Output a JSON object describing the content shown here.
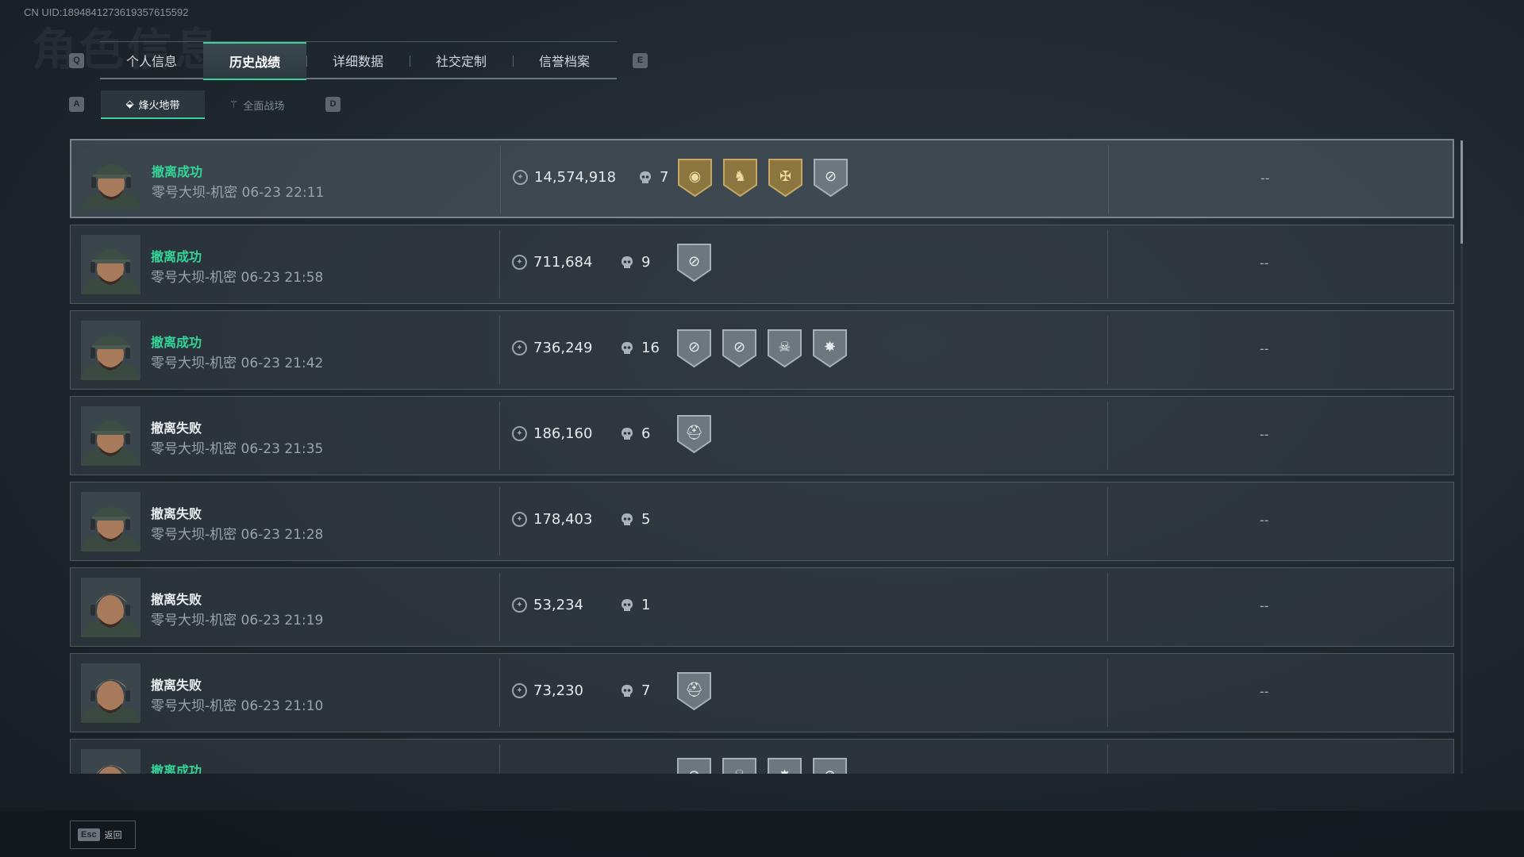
{
  "header": {
    "uid": "CN UID:1894841273619357615592",
    "watermark": "角色信息",
    "key_left": "Q",
    "key_right": "E",
    "sub_key_left": "A",
    "sub_key_right": "D"
  },
  "tabs": [
    {
      "label": "个人信息",
      "active": false
    },
    {
      "label": "历史战绩",
      "active": true
    },
    {
      "label": "详细数据",
      "active": false
    },
    {
      "label": "社交定制",
      "active": false
    },
    {
      "label": "信誉档案",
      "active": false
    }
  ],
  "subtabs": [
    {
      "label": "烽火地带",
      "icon": "extraction-icon",
      "active": true
    },
    {
      "label": "全面战场",
      "icon": "battlefield-icon",
      "active": false
    }
  ],
  "rows": [
    {
      "status": "撤离成功",
      "result": "success",
      "map_time": "零号大坝-机密 06-23 22:11",
      "value": "14,574,918",
      "kills": "7",
      "badges": [
        "gold-shield-badge",
        "gold-helmet-badge",
        "gold-soldier-badge",
        "silver-crosshair-badge"
      ],
      "extra": "--",
      "avatar": "cap-operator"
    },
    {
      "status": "撤离成功",
      "result": "success",
      "map_time": "零号大坝-机密 06-23 21:58",
      "value": "711,684",
      "kills": "9",
      "badges": [
        "silver-crosshair-badge"
      ],
      "extra": "--",
      "avatar": "cap-operator"
    },
    {
      "status": "撤离成功",
      "result": "success",
      "map_time": "零号大坝-机密 06-23 21:42",
      "value": "736,249",
      "kills": "16",
      "badges": [
        "silver-crosshair-badge",
        "silver-crosshair-badge",
        "silver-skull-badge",
        "silver-burst-badge"
      ],
      "extra": "--",
      "avatar": "cap-operator"
    },
    {
      "status": "撤离失败",
      "result": "fail",
      "map_time": "零号大坝-机密 06-23 21:35",
      "value": "186,160",
      "kills": "6",
      "badges": [
        "silver-helmet-badge"
      ],
      "extra": "--",
      "avatar": "cap-operator"
    },
    {
      "status": "撤离失败",
      "result": "fail",
      "map_time": "零号大坝-机密 06-23 21:28",
      "value": "178,403",
      "kills": "5",
      "badges": [],
      "extra": "--",
      "avatar": "cap-operator"
    },
    {
      "status": "撤离失败",
      "result": "fail",
      "map_time": "零号大坝-机密 06-23 21:19",
      "value": "53,234",
      "kills": "1",
      "badges": [],
      "extra": "--",
      "avatar": "blond-operator"
    },
    {
      "status": "撤离失败",
      "result": "fail",
      "map_time": "零号大坝-机密 06-23 21:10",
      "value": "73,230",
      "kills": "7",
      "badges": [
        "silver-helmet-badge"
      ],
      "extra": "--",
      "avatar": "blond-operator"
    },
    {
      "status": "撤离成功",
      "result": "success",
      "map_time": "",
      "value": "",
      "kills": "",
      "badges": [
        "silver-crosshair-badge",
        "silver-skull-badge",
        "silver-burst-badge",
        "silver-crosshair-badge"
      ],
      "extra": "",
      "avatar": "blond-operator"
    }
  ],
  "footer": {
    "esc_key": "Esc",
    "back_label": "返回"
  },
  "colors": {
    "accent": "#3ad19a",
    "success": "#33d497",
    "gold": "#b89a4e",
    "silver": "#8e999f"
  }
}
